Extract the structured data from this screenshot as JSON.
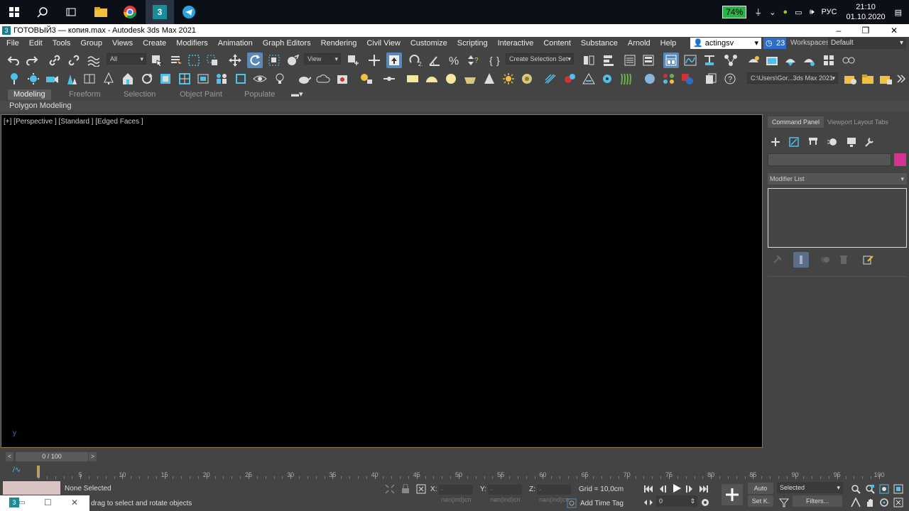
{
  "taskbar": {
    "battery": "74%",
    "lang": "РУС",
    "time": "21:10",
    "date": "01.10.2020",
    "icons": [
      "windows-start-icon",
      "search-icon",
      "task-view-icon",
      "file-explorer-icon",
      "chrome-icon",
      "3dsmax-icon",
      "telegram-icon"
    ]
  },
  "window": {
    "title": "ГОТОВЫЙ3 — копия.max - Autodesk 3ds Max 2021"
  },
  "menu": {
    "items": [
      "File",
      "Edit",
      "Tools",
      "Group",
      "Views",
      "Create",
      "Modifiers",
      "Animation",
      "Graph Editors",
      "Rendering",
      "Civil View",
      "Customize",
      "Scripting",
      "Interactive",
      "Content",
      "Substance",
      "Arnold",
      "Help"
    ],
    "user": "actingsv",
    "notif_count": "23",
    "workspaces_label": "Workspaces:",
    "workspace_value": "Default"
  },
  "toolbar": {
    "selection_filter": "All",
    "ref_coord": "View",
    "named_selection": "Create Selection Set",
    "project_path": "C:\\Users\\Gor...3ds Max 2021"
  },
  "ribbon": {
    "tabs": [
      "Modeling",
      "Freeform",
      "Selection",
      "Object Paint",
      "Populate"
    ],
    "active_tab": "Modeling",
    "subpanel": "Polygon Modeling"
  },
  "viewport": {
    "label": "[+] [Perspective ] [Standard ] [Edged Faces ]",
    "axis": "y"
  },
  "command_panel": {
    "tab_command": "Command Panel",
    "tab_layout": "Viewport Layout Tabs",
    "modifier_list": "Modifier List",
    "object_color": "#d6338f"
  },
  "timeline": {
    "frame_display": "0 / 100",
    "ticks": [
      "5",
      "10",
      "15",
      "20",
      "25",
      "30",
      "35",
      "40",
      "45",
      "50",
      "55",
      "60",
      "65",
      "70",
      "75",
      "80",
      "85",
      "90",
      "95",
      "100"
    ]
  },
  "status": {
    "selection": "None Selected",
    "prompt": "drag to select and rotate objects",
    "x_label": "X:",
    "y_label": "Y:",
    "z_label": "Z:",
    "x_value": "-nan(ind)cn",
    "y_value": "-nan(ind)cn",
    "z_value": "-nan(ind)cn",
    "grid": "Grid = 10,0cm",
    "add_time_tag": "Add Time Tag",
    "auto_key": "Auto",
    "set_key": "Set K.",
    "key_filter_value": "Selected",
    "filters": "Filters...",
    "frame_spinner": "0"
  }
}
